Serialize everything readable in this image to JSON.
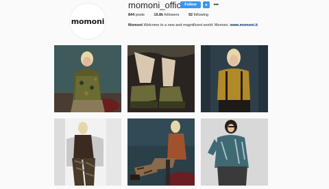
{
  "profile": {
    "avatar_text": "momoni",
    "username": "momoni_official",
    "follow_label": "Follow",
    "dropdown_label": "▾",
    "more_label": "•••",
    "stats": [
      {
        "count": "844",
        "label": "posts"
      },
      {
        "count": "16.8k",
        "label": "followers"
      },
      {
        "count": "92",
        "label": "following"
      }
    ],
    "bio_name": "Momoni",
    "bio_text": "Welcome to a new and magnificent world: Momoni.",
    "bio_link": "www.momoni.it"
  },
  "colors": {
    "accent": "#3897f0",
    "link": "#003569",
    "background": "#fafafa"
  },
  "posts": [
    {
      "scene": "woman-in-patterned-jacket-teal-wall"
    },
    {
      "scene": "legs-in-sequin-skirt-and-boots"
    },
    {
      "scene": "woman-in-mustard-top-dark-backdrop"
    },
    {
      "scene": "seated-woman-on-armchair-white-room"
    },
    {
      "scene": "woman-in-orange-blazer-on-stool"
    },
    {
      "scene": "woman-in-velvet-blazer-grey-backdrop"
    }
  ]
}
